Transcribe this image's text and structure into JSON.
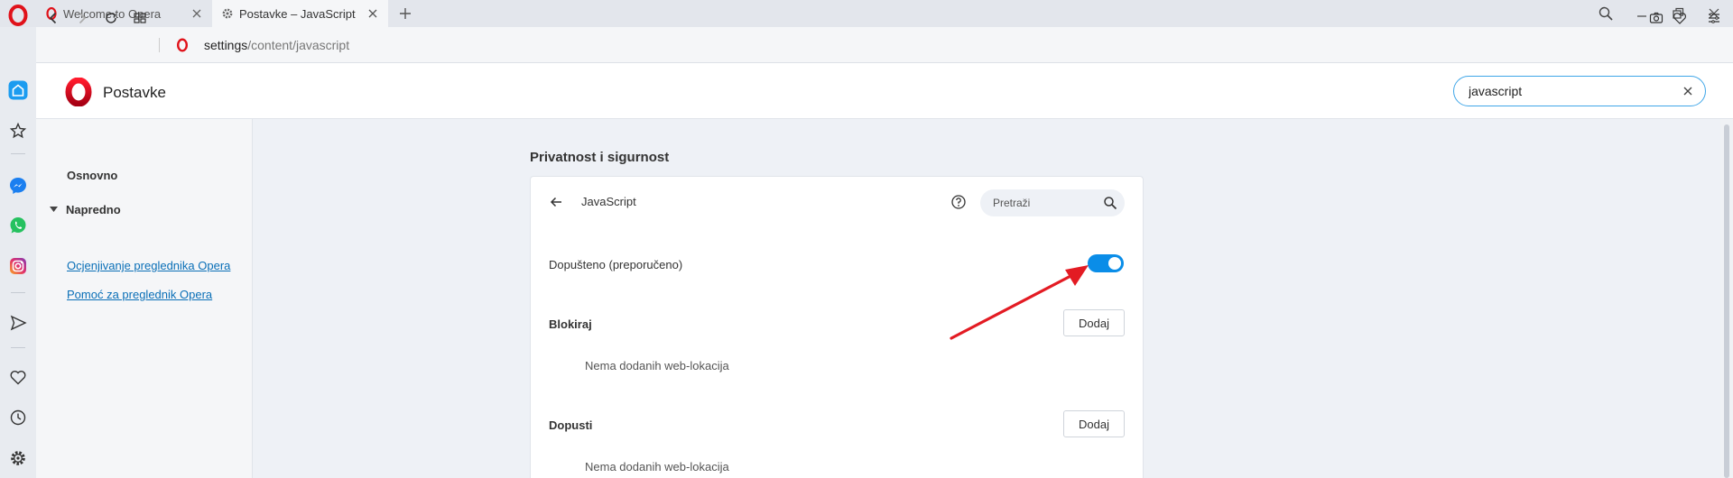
{
  "tabs": [
    {
      "title": "Welcome to Opera",
      "active": false
    },
    {
      "title": "Postavke – JavaScript",
      "active": true
    }
  ],
  "address": {
    "host": "settings",
    "path": "/content/javascript"
  },
  "settings": {
    "title": "Postavke"
  },
  "search": {
    "value": "javascript"
  },
  "nav": {
    "basic": "Osnovno",
    "advanced": "Napredno",
    "rate_link": "Ocjenjivanje preglednika Opera",
    "help_link": "Pomoć za preglednik Opera"
  },
  "main": {
    "section_title": "Privatnost i sigurnost",
    "card_title": "JavaScript",
    "search_placeholder": "Pretraži",
    "allowed_label": "Dopušteno (preporučeno)",
    "allowed_on": true,
    "block_label": "Blokiraj",
    "allow_label": "Dopusti",
    "add_label": "Dodaj",
    "empty_text": "Nema dodanih web-lokacija"
  },
  "colors": {
    "accent": "#0a8de8",
    "opera_red": "#e0121a",
    "annotation": "#e31b23"
  },
  "icons": [
    "opera-logo-icon",
    "gear-icon",
    "close-icon",
    "plus-icon",
    "search-icon",
    "minimize-icon",
    "restore-icon",
    "back-icon",
    "forward-icon",
    "reload-icon",
    "grid-icon",
    "camera-icon",
    "heart-icon",
    "menu-icon",
    "home-icon",
    "star-icon",
    "messenger-icon",
    "whatsapp-icon",
    "instagram-icon",
    "send-icon",
    "history-icon",
    "help-icon",
    "arrow-left-icon",
    "caret-down-icon"
  ]
}
